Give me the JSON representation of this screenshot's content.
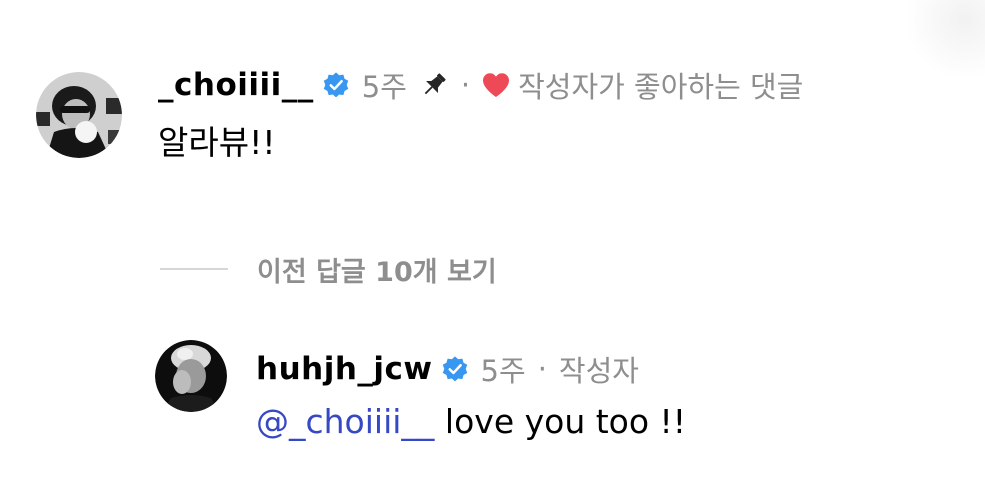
{
  "comment": {
    "username": "_choiiii__",
    "verified": true,
    "time": "5주",
    "pinned": true,
    "separator": "·",
    "liked_by_author_label": "작성자가 좋아하는 댓글",
    "text": "알라뷰!!"
  },
  "view_previous_replies": {
    "label": "이전 답글 10개 보기"
  },
  "reply": {
    "username": "huhjh_jcw",
    "verified": true,
    "time": "5주",
    "separator": "·",
    "author_badge": "작성자",
    "mention": "@_choiiii__",
    "text": " love you too !!"
  },
  "colors": {
    "verified_blue": "#3897f0",
    "heart_red": "#ed4956",
    "meta_gray": "#8e8e8e",
    "mention_blue": "#3748c4"
  },
  "icons": {
    "verified": "verified-badge-icon",
    "pin": "pin-icon",
    "heart": "heart-icon"
  }
}
